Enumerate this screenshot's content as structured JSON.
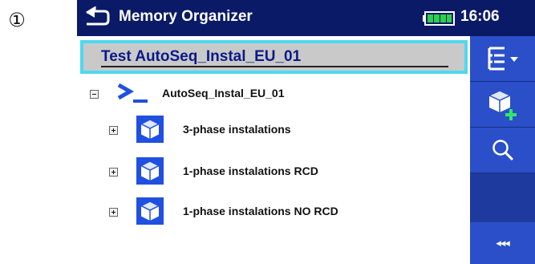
{
  "step_marker": "①",
  "header": {
    "title": "Memory Organizer",
    "time": "16:06",
    "back_icon": "back-arrow-icon",
    "battery_icon": "battery-full-icon"
  },
  "selected": {
    "text": "Test AutoSeq_Instal_EU_01"
  },
  "tree": {
    "root": {
      "label": "AutoSeq_Instal_EU_01",
      "icon": "auto-sequence-icon",
      "expanded": true
    },
    "children": [
      {
        "label": "3-phase instalations",
        "icon": "structure-cube-icon"
      },
      {
        "label": "1-phase instalations RCD",
        "icon": "structure-cube-icon"
      },
      {
        "label": "1-phase instalations NO RCD",
        "icon": "structure-cube-icon"
      }
    ]
  },
  "sidebar": {
    "buttons": [
      "tree-options-icon",
      "add-structure-icon",
      "search-icon"
    ],
    "collapse_label": "◂◂◂"
  },
  "colors": {
    "header": "#0b1a66",
    "sidebar": "#1f3a9e",
    "button": "#2a4fc8",
    "selection_border": "#4fd8f0",
    "selection_bg": "#c9c9c9",
    "cube": "#1f50e0",
    "text_selected": "#0b1a88"
  }
}
